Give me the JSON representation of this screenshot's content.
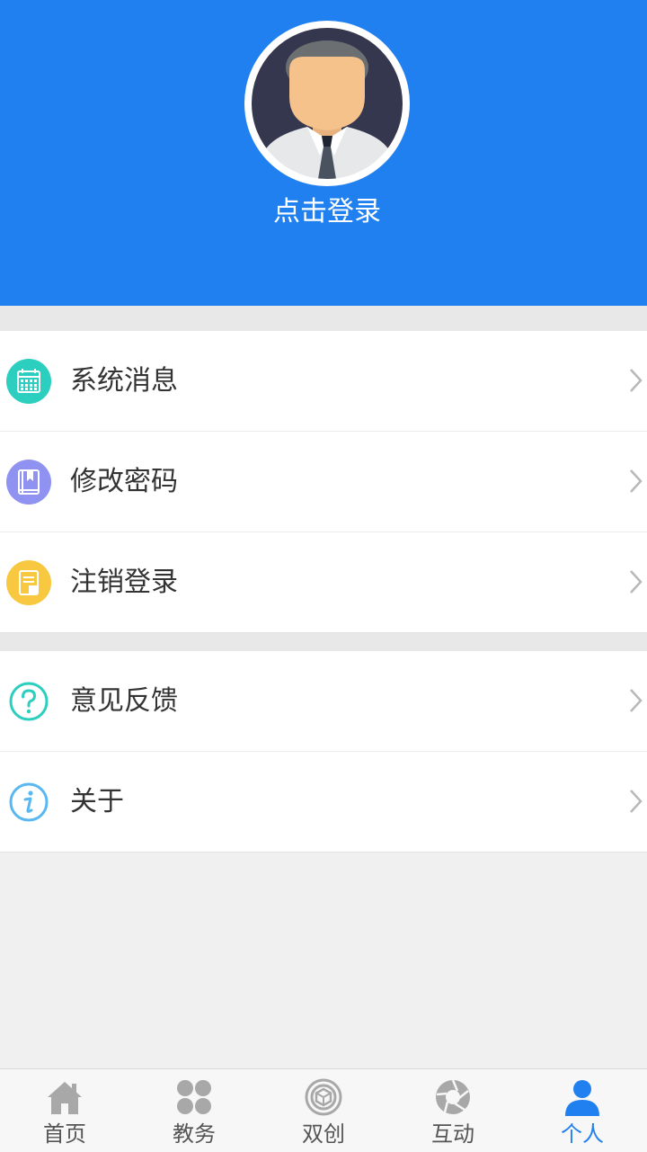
{
  "header": {
    "login_text": "点击登录",
    "background_color": "#2080f0"
  },
  "menu_groups": [
    {
      "items": [
        {
          "label": "系统消息",
          "icon": "calendar-icon",
          "icon_color": "#2ccfbf"
        },
        {
          "label": "修改密码",
          "icon": "book-icon",
          "icon_color": "#8f92f0"
        },
        {
          "label": "注销登录",
          "icon": "document-icon",
          "icon_color": "#f8c840"
        }
      ]
    },
    {
      "items": [
        {
          "label": "意见反馈",
          "icon": "question-icon",
          "icon_color": "#2ccfbf"
        },
        {
          "label": "关于",
          "icon": "info-icon",
          "icon_color": "#5ab8f0"
        }
      ]
    }
  ],
  "tabbar": {
    "active_color": "#2080f0",
    "inactive_color": "#a8a8a8",
    "tabs": [
      {
        "label": "首页",
        "icon": "home-icon",
        "active": false
      },
      {
        "label": "教务",
        "icon": "grid-icon",
        "active": false
      },
      {
        "label": "双创",
        "icon": "hexagon-icon",
        "active": false
      },
      {
        "label": "互动",
        "icon": "aperture-icon",
        "active": false
      },
      {
        "label": "个人",
        "icon": "person-icon",
        "active": true
      }
    ]
  }
}
